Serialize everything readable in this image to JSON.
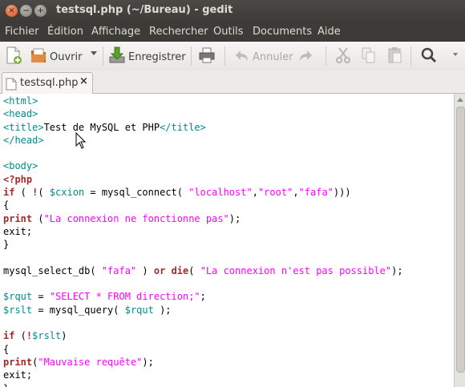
{
  "window": {
    "title": "testsql.php (~/Bureau) - gedit",
    "buttons": {
      "close": "×",
      "minimize": "−",
      "maximize": "+"
    }
  },
  "menu": [
    "Fichier",
    "Édition",
    "Affichage",
    "Rechercher",
    "Outils",
    "Documents",
    "Aide"
  ],
  "toolbar": {
    "open_label": "Ouvrir",
    "save_label": "Enregistrer",
    "undo_label": "Annuler"
  },
  "tab": {
    "name": "testsql.php",
    "close": "×"
  },
  "colors": {
    "tag": "#008a8c",
    "keyword": "#a52a2a",
    "string": "#ff00ff",
    "variable": "#008a8c"
  },
  "code": [
    [
      [
        "tag",
        "<html>"
      ]
    ],
    [
      [
        "tag",
        "<head>"
      ]
    ],
    [
      [
        "tag",
        "<title>"
      ],
      [
        "txt",
        "Test de MySQL et PHP"
      ],
      [
        "tag",
        "</title>"
      ]
    ],
    [
      [
        "tag",
        "</head>"
      ]
    ],
    [],
    [
      [
        "tag",
        "<body>"
      ]
    ],
    [
      [
        "kw",
        "<?php"
      ]
    ],
    [
      [
        "kw",
        "if"
      ],
      [
        "pl",
        " ( "
      ],
      [
        "kw",
        "!"
      ],
      [
        "pl",
        "( "
      ],
      [
        "var",
        "$cxion"
      ],
      [
        "pl",
        " = mysql_connect( "
      ],
      [
        "str",
        "\"localhost\""
      ],
      [
        "pl",
        ","
      ],
      [
        "str",
        "\"root\""
      ],
      [
        "pl",
        ","
      ],
      [
        "str",
        "\"fafa\""
      ],
      [
        "pl",
        ")))"
      ]
    ],
    [
      [
        "pl",
        "{"
      ]
    ],
    [
      [
        "kw",
        "print"
      ],
      [
        "pl",
        " ("
      ],
      [
        "str",
        "\"La connexion ne fonctionne pas\""
      ],
      [
        "pl",
        ");"
      ]
    ],
    [
      [
        "pl",
        "exit;"
      ]
    ],
    [
      [
        "pl",
        "}"
      ]
    ],
    [],
    [
      [
        "pl",
        "mysql_select_db( "
      ],
      [
        "str",
        "\"fafa\""
      ],
      [
        "pl",
        " ) "
      ],
      [
        "kw",
        "or"
      ],
      [
        "pl",
        " "
      ],
      [
        "kw",
        "die"
      ],
      [
        "pl",
        "( "
      ],
      [
        "str",
        "\"La connexion n'est pas possible\""
      ],
      [
        "pl",
        ");"
      ]
    ],
    [],
    [
      [
        "var",
        "$rqut"
      ],
      [
        "pl",
        " = "
      ],
      [
        "str",
        "\"SELECT * FROM direction;\""
      ],
      [
        "pl",
        ";"
      ]
    ],
    [
      [
        "var",
        "$rslt"
      ],
      [
        "pl",
        " = mysql_query( "
      ],
      [
        "var",
        "$rqut"
      ],
      [
        "pl",
        " );"
      ]
    ],
    [],
    [
      [
        "kw",
        "if"
      ],
      [
        "pl",
        " ("
      ],
      [
        "kw",
        "!"
      ],
      [
        "var",
        "$rslt"
      ],
      [
        "pl",
        ")"
      ]
    ],
    [
      [
        "pl",
        "{"
      ]
    ],
    [
      [
        "kw",
        "print"
      ],
      [
        "pl",
        "("
      ],
      [
        "str",
        "\"Mauvaise requête\""
      ],
      [
        "pl",
        ");"
      ]
    ],
    [
      [
        "pl",
        "exit;"
      ]
    ],
    [
      [
        "pl",
        "}"
      ]
    ]
  ]
}
